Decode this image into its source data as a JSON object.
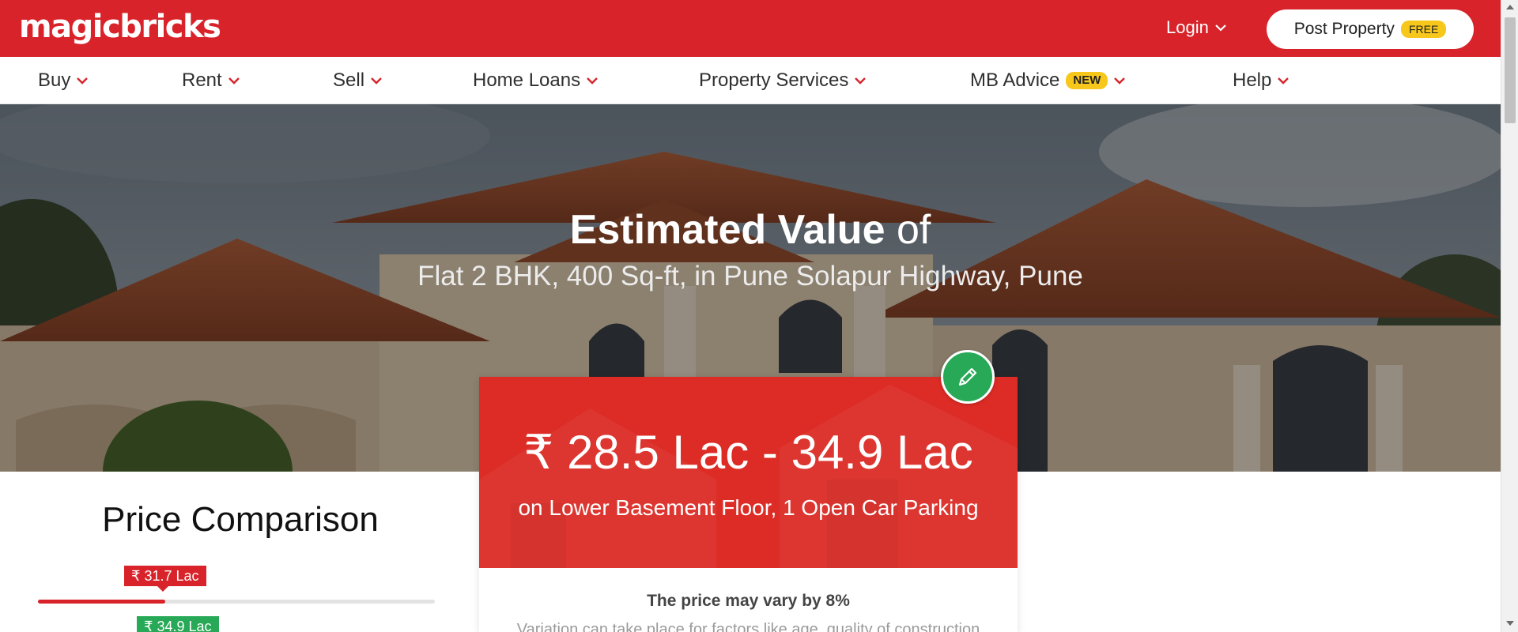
{
  "header": {
    "logo_text": "magicbricks",
    "login_label": "Login",
    "post_property_label": "Post Property",
    "free_badge": "FREE",
    "brand_color": "#d8232a"
  },
  "nav": {
    "items": [
      {
        "label": "Buy"
      },
      {
        "label": "Rent"
      },
      {
        "label": "Sell"
      },
      {
        "label": "Home Loans"
      },
      {
        "label": "Property Services"
      },
      {
        "label": "MB Advice",
        "badge": "NEW"
      },
      {
        "label": "Help"
      }
    ],
    "chevron_icon": "chevron-down-icon"
  },
  "hero": {
    "title_bold": "Estimated Value",
    "title_rest": "of",
    "subtitle": "Flat 2 BHK, 400 Sq-ft, in Pune Solapur Highway, Pune"
  },
  "estimate": {
    "price_range": "₹ 28.5 Lac - 34.9 Lac",
    "details": "on Lower Basement Floor, 1 Open Car Parking",
    "vary_title": "The price may vary by 8%",
    "vary_text": "Variation can take place for factors like age, quality of construction",
    "edit_icon": "pencil-icon",
    "accent_color": "#dc2c25",
    "edit_color": "#27a957"
  },
  "comparison": {
    "title": "Price Comparison",
    "marker_value": "₹ 31.7 Lac",
    "marker_fraction": 0.32,
    "max_value": "₹ 34.9 Lac"
  }
}
